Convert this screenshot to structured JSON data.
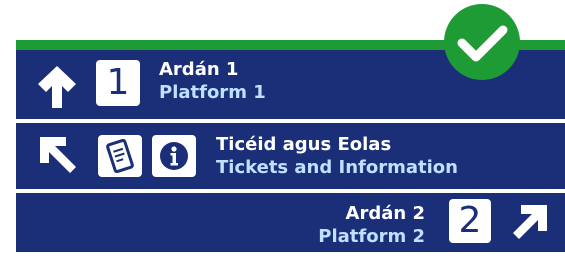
{
  "colors": {
    "navy": "#1b2f78",
    "green": "#1f9b35",
    "light_blue": "#bfe0ff",
    "white": "#ffffff"
  },
  "status_icon": "check-circle-icon",
  "rows": [
    {
      "icon": "arrow-up-icon",
      "tile": "1",
      "ga": "Ardán 1",
      "en": "Platform 1"
    },
    {
      "icon": "arrow-up-left-icon",
      "tiles": [
        "ticket-icon",
        "information-icon"
      ],
      "ga": "Ticéid agus Eolas",
      "en": "Tickets and Information"
    },
    {
      "icon": "arrow-up-right-icon",
      "tile": "2",
      "ga": "Ardán 2",
      "en": "Platform 2"
    }
  ]
}
